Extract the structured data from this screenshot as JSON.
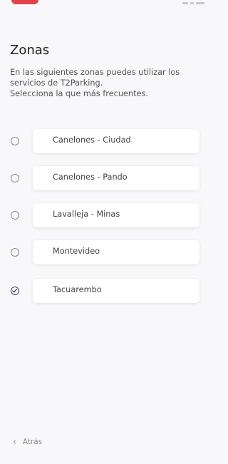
{
  "header": {
    "title": "Zonas",
    "subtitle_lines": [
      "En las siguientes zonas puedes utilizar los",
      "servicios de T2Parking.",
      "Selecciona la que más frecuentes."
    ]
  },
  "zones": [
    {
      "label": "Canelones - Ciudad",
      "selected": false
    },
    {
      "label": "Canelones - Pando",
      "selected": false
    },
    {
      "label": "Lavalleja - Minas",
      "selected": false
    },
    {
      "label": "Montevideo",
      "selected": false
    },
    {
      "label": "Tacuarembo",
      "selected": true
    }
  ],
  "footer": {
    "back_label": "Atrás",
    "back_icon": "chevron-left-icon"
  },
  "colors": {
    "accent": "#4c3a75",
    "status_pill": "#e2434b",
    "background": "#f8f8fa"
  }
}
